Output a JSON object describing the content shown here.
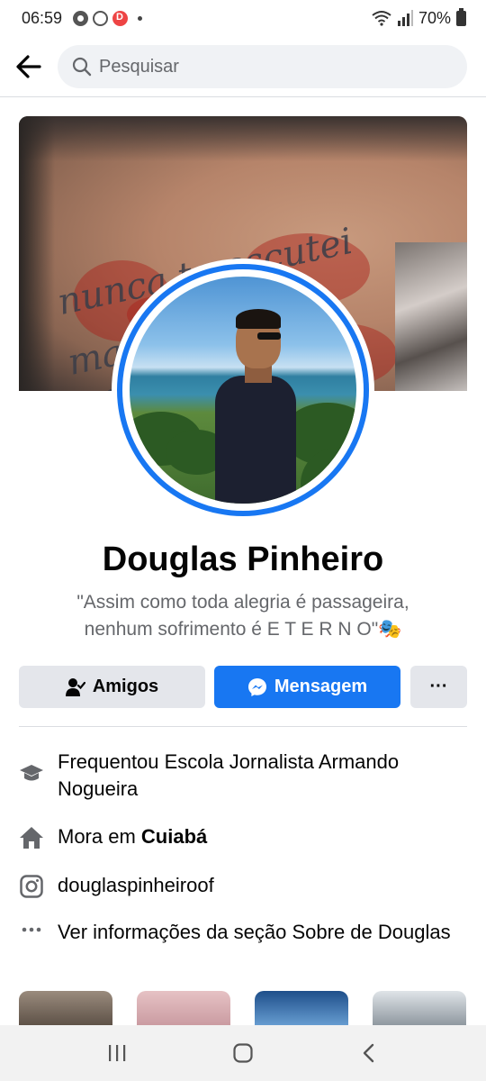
{
  "status_bar": {
    "time": "06:59",
    "battery": "70%",
    "icons": [
      "chrome-icon",
      "whatsapp-icon",
      "app-d-icon",
      "dot-icon",
      "wifi-icon",
      "signal-icon",
      "battery-icon"
    ]
  },
  "header": {
    "search_placeholder": "Pesquisar"
  },
  "profile": {
    "name": "Douglas Pinheiro",
    "bio_line1": "\"Assim como toda alegria é passageira,",
    "bio_line2": "nenhum sofrimento é  E T E R N O\"🎭"
  },
  "actions": {
    "friends_label": "Amigos",
    "message_label": "Mensagem",
    "more_label": "···"
  },
  "details": {
    "education": "Frequentou Escola Jornalista Armando Nogueira",
    "lives_prefix": "Mora em ",
    "lives_city": "Cuiabá",
    "instagram": "douglaspinheiroof",
    "about": "Ver informações da seção Sobre de Douglas"
  },
  "colors": {
    "accent": "#1877f2",
    "button_gray": "#e4e6eb",
    "text_primary": "#050505",
    "text_secondary": "#65676b"
  }
}
